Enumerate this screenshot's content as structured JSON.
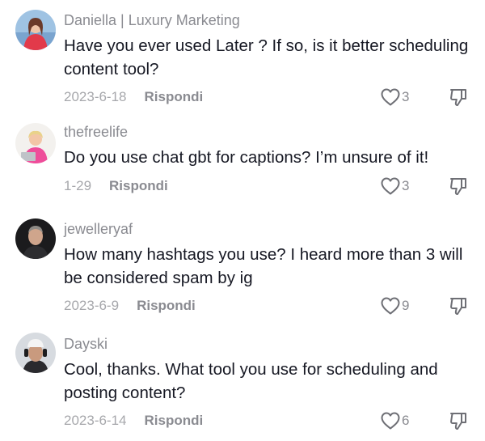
{
  "colors": {
    "text": "#161823",
    "muted": "#8a8b91",
    "date": "#a7a8ac",
    "icon": "#6e6f75"
  },
  "comments": [
    {
      "username": "Daniella | Luxury Marketing",
      "text": "Have you ever used Later ? If so, is it better scheduling content tool?",
      "date": "2023-6-18",
      "reply_label": "Rispondi",
      "likes": "3",
      "avatar_icon": "avatar-photo-woman-red"
    },
    {
      "username": "thefreelife",
      "text": "Do you use chat gbt for captions? I’m unsure of it!",
      "date": "1-29",
      "reply_label": "Rispondi",
      "likes": "3",
      "avatar_icon": "avatar-photo-woman-pink-laptop"
    },
    {
      "username": "jewelleryaf",
      "text": "How many hashtags you use? I heard more than 3 will be considered spam by ig",
      "date": "2023-6-9",
      "reply_label": "Rispondi",
      "likes": "9",
      "avatar_icon": "avatar-photo-man"
    },
    {
      "username": "Dayski",
      "text": "Cool, thanks. What tool you use for scheduling and posting content?",
      "date": "2023-6-14",
      "reply_label": "Rispondi",
      "likes": "6",
      "avatar_icon": "avatar-photo-man-headphones"
    }
  ]
}
